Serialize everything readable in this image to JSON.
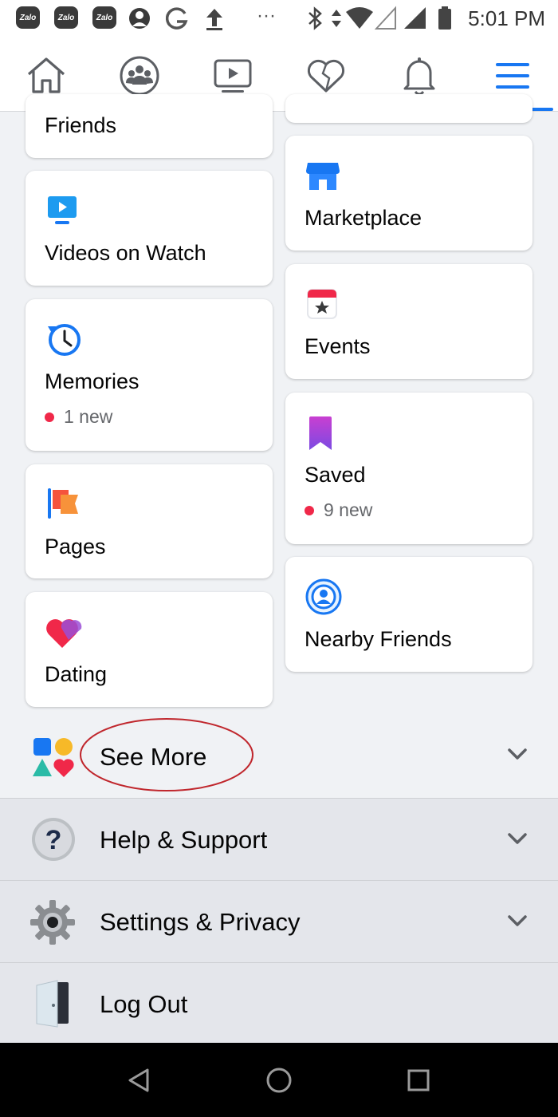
{
  "status_bar": {
    "apps": [
      "Zalo",
      "Zalo",
      "Zalo"
    ],
    "overflow": "···",
    "time": "5:01 PM",
    "icons": [
      "zalo-icon",
      "zalo-icon",
      "zalo-icon",
      "avatar-icon",
      "google-icon",
      "upload-icon",
      "bluetooth-icon",
      "data-arrows-icon",
      "wifi-icon",
      "signal-empty-icon",
      "signal-icon",
      "battery-icon"
    ]
  },
  "top_nav": {
    "tabs": [
      "home",
      "groups",
      "watch",
      "dating",
      "notifications",
      "menu"
    ],
    "active": "menu",
    "accent": "#1877f2"
  },
  "shortcuts": {
    "left": [
      {
        "label": "Friends",
        "icon": "friends-icon"
      },
      {
        "label": "Videos on Watch",
        "icon": "watch-video-icon"
      },
      {
        "label": "Memories",
        "badge": "1 new",
        "icon": "memories-clock-icon"
      },
      {
        "label": "Pages",
        "icon": "pages-flag-icon"
      },
      {
        "label": "Dating",
        "icon": "dating-heart-icon"
      }
    ],
    "right": [
      {
        "label": "Marketplace",
        "icon": "marketplace-shop-icon"
      },
      {
        "label": "Events",
        "icon": "events-calendar-icon"
      },
      {
        "label": "Saved",
        "badge": "9 new",
        "icon": "saved-bookmark-icon"
      },
      {
        "label": "Nearby Friends",
        "icon": "nearby-friends-icon"
      }
    ]
  },
  "menu_rows": {
    "see_more": "See More",
    "help_support": "Help & Support",
    "settings_privacy": "Settings & Privacy",
    "log_out": "Log Out"
  },
  "colors": {
    "badge_dot": "#f02849",
    "annotation_circle": "#c0272d",
    "section_bg": "#e4e6eb"
  }
}
